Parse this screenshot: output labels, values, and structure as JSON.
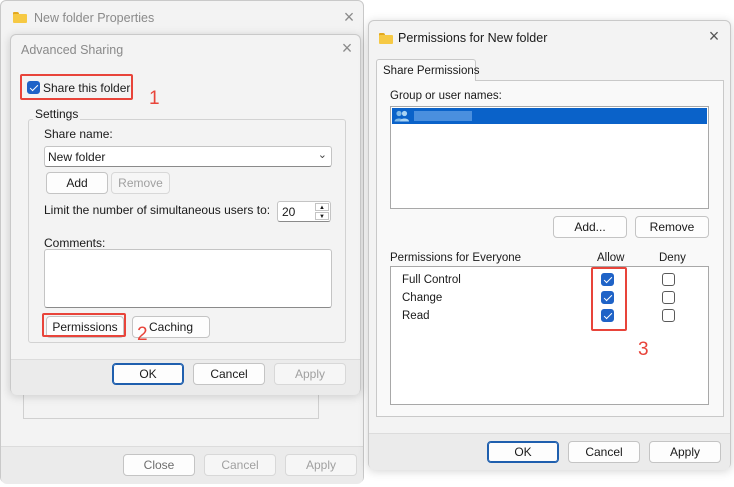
{
  "properties_window": {
    "title": "New folder Properties",
    "buttons": {
      "close": "Close",
      "cancel": "Cancel",
      "apply": "Apply"
    }
  },
  "advanced_sharing": {
    "title": "Advanced Sharing",
    "share_checkbox_label": "Share this folder",
    "share_checked": true,
    "settings_group_label": "Settings",
    "share_name_label": "Share name:",
    "share_name_value": "New folder",
    "add_button": "Add",
    "remove_button": "Remove",
    "limit_label": "Limit the number of simultaneous users to:",
    "limit_value": "20",
    "comments_label": "Comments:",
    "comments_value": "",
    "permissions_button": "Permissions",
    "caching_button": "Caching",
    "ok_button": "OK",
    "cancel_button": "Cancel",
    "apply_button": "Apply"
  },
  "permissions_window": {
    "title": "Permissions for New folder",
    "tab_label": "Share Permissions",
    "group_label": "Group or user names:",
    "add_button": "Add...",
    "remove_button": "Remove",
    "perm_for_label": "Permissions for Everyone",
    "allow_header": "Allow",
    "deny_header": "Deny",
    "permissions": [
      {
        "name": "Full Control",
        "allow": true,
        "deny": false
      },
      {
        "name": "Change",
        "allow": true,
        "deny": false
      },
      {
        "name": "Read",
        "allow": true,
        "deny": false
      }
    ],
    "ok_button": "OK",
    "cancel_button": "Cancel",
    "apply_button": "Apply"
  },
  "annotations": {
    "step1": "1",
    "step2": "2",
    "step3": "3"
  },
  "colors": {
    "accent": "#1f63c7",
    "selection": "#0a62c9",
    "annotation": "#e8443a"
  }
}
